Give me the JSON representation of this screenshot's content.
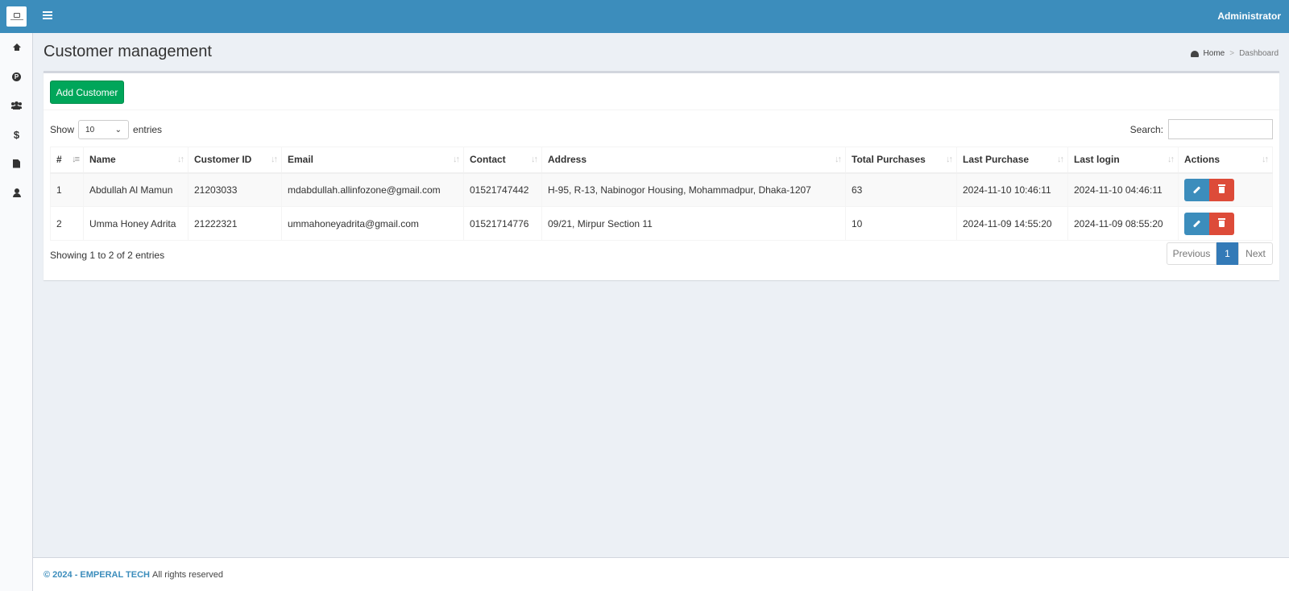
{
  "header": {
    "user": "Administrator"
  },
  "sidebar": {
    "items": [
      {
        "name": "home",
        "icon": "home-icon"
      },
      {
        "name": "products",
        "icon": "p-circle-icon",
        "glyph": "P"
      },
      {
        "name": "customers",
        "icon": "users-icon"
      },
      {
        "name": "sales",
        "icon": "dollar-icon",
        "glyph": "$"
      },
      {
        "name": "reports",
        "icon": "file-icon"
      },
      {
        "name": "profile",
        "icon": "user-icon"
      }
    ]
  },
  "page": {
    "title": "Customer management"
  },
  "breadcrumb": {
    "home": "Home",
    "current": "Dashboard"
  },
  "toolbar": {
    "add_label": "Add Customer"
  },
  "table_controls": {
    "show_label": "Show",
    "entries_value": "10",
    "entries_label": "entries",
    "search_label": "Search:",
    "search_value": ""
  },
  "table": {
    "columns": [
      "#",
      "Name",
      "Customer ID",
      "Email",
      "Contact",
      "Address",
      "Total Purchases",
      "Last Purchase",
      "Last login",
      "Actions"
    ],
    "rows": [
      [
        "1",
        "Abdullah Al Mamun",
        "21203033",
        "mdabdullah.allinfozone@gmail.com",
        "01521747442",
        "H-95, R-13, Nabinogor Housing, Mohammadpur, Dhaka-1207",
        "63",
        "2024-11-10 10:46:11",
        "2024-11-10 04:46:11"
      ],
      [
        "2",
        "Umma Honey Adrita",
        "21222321",
        "ummahoneyadrita@gmail.com",
        "01521714776",
        "09/21, Mirpur Section 11",
        "10",
        "2024-11-09 14:55:20",
        "2024-11-09 08:55:20"
      ]
    ]
  },
  "pagination": {
    "info": "Showing 1 to 2 of 2 entries",
    "previous": "Previous",
    "current_page": "1",
    "next": "Next"
  },
  "footer": {
    "copyright": "© 2024 - EMPERAL TECH",
    "rights": "All rights reserved"
  },
  "colors": {
    "primary": "#3c8dbc",
    "success": "#00a65a",
    "danger": "#dd4b39",
    "page_bg": "#ecf0f5"
  }
}
